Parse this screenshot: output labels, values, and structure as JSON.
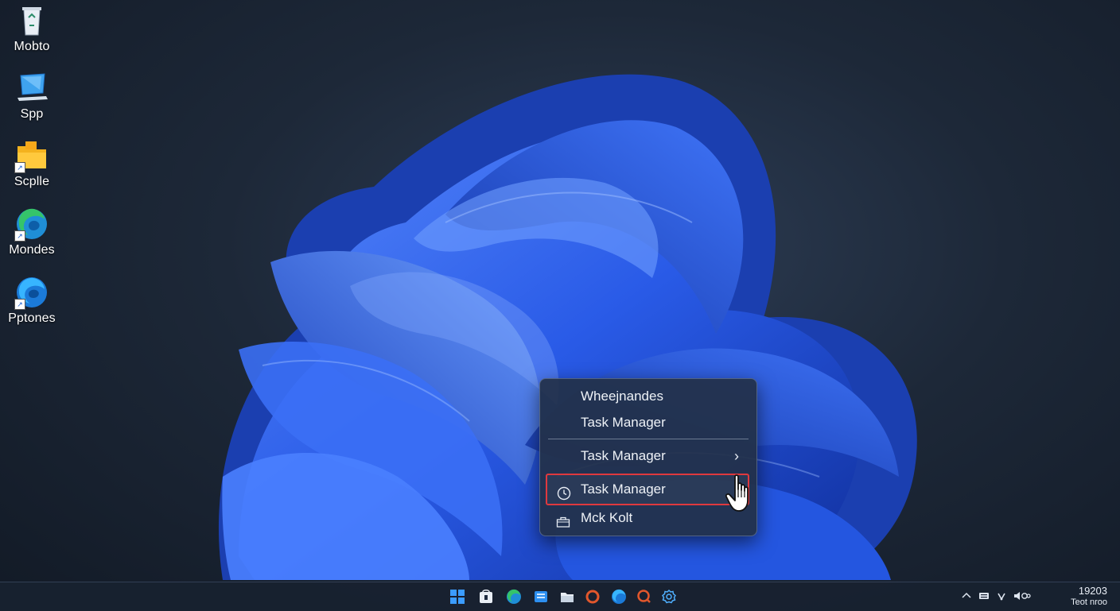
{
  "desktop": {
    "icons": [
      {
        "label": "Mobto",
        "icon": "recycle-bin-icon"
      },
      {
        "label": "Spp",
        "icon": "computer-icon"
      },
      {
        "label": "Scplle",
        "icon": "folder-icon"
      },
      {
        "label": "Mondes",
        "icon": "edge-color-icon"
      },
      {
        "label": "Pptones",
        "icon": "edge-icon"
      }
    ]
  },
  "context_menu": {
    "items": [
      {
        "label": "Wheejnandes",
        "icon": ""
      },
      {
        "label": "Task Manager",
        "icon": ""
      },
      {
        "label": "Task Manager",
        "icon": "",
        "submenu": true
      },
      {
        "label": "Task Manager",
        "icon": "clock-icon",
        "highlighted": true
      },
      {
        "label": "Mck Kolt",
        "icon": "briefcase-icon"
      }
    ],
    "highlight_color": "#e0393e"
  },
  "taskbar": {
    "apps": [
      "start-icon",
      "store-icon",
      "edge-icon",
      "widgets-icon",
      "file-explorer-icon",
      "office-icon",
      "edge-icon",
      "search-app-icon",
      "settings-icon"
    ],
    "tray_icons": [
      "chevron-up-icon",
      "keyboard-icon",
      "wifi-icon",
      "volume-icon"
    ],
    "clock": {
      "time": "19203",
      "date": "Teot nroo"
    }
  },
  "colors": {
    "accent": "#2f6cf2",
    "wallpaper_bg": "#1d2838"
  }
}
